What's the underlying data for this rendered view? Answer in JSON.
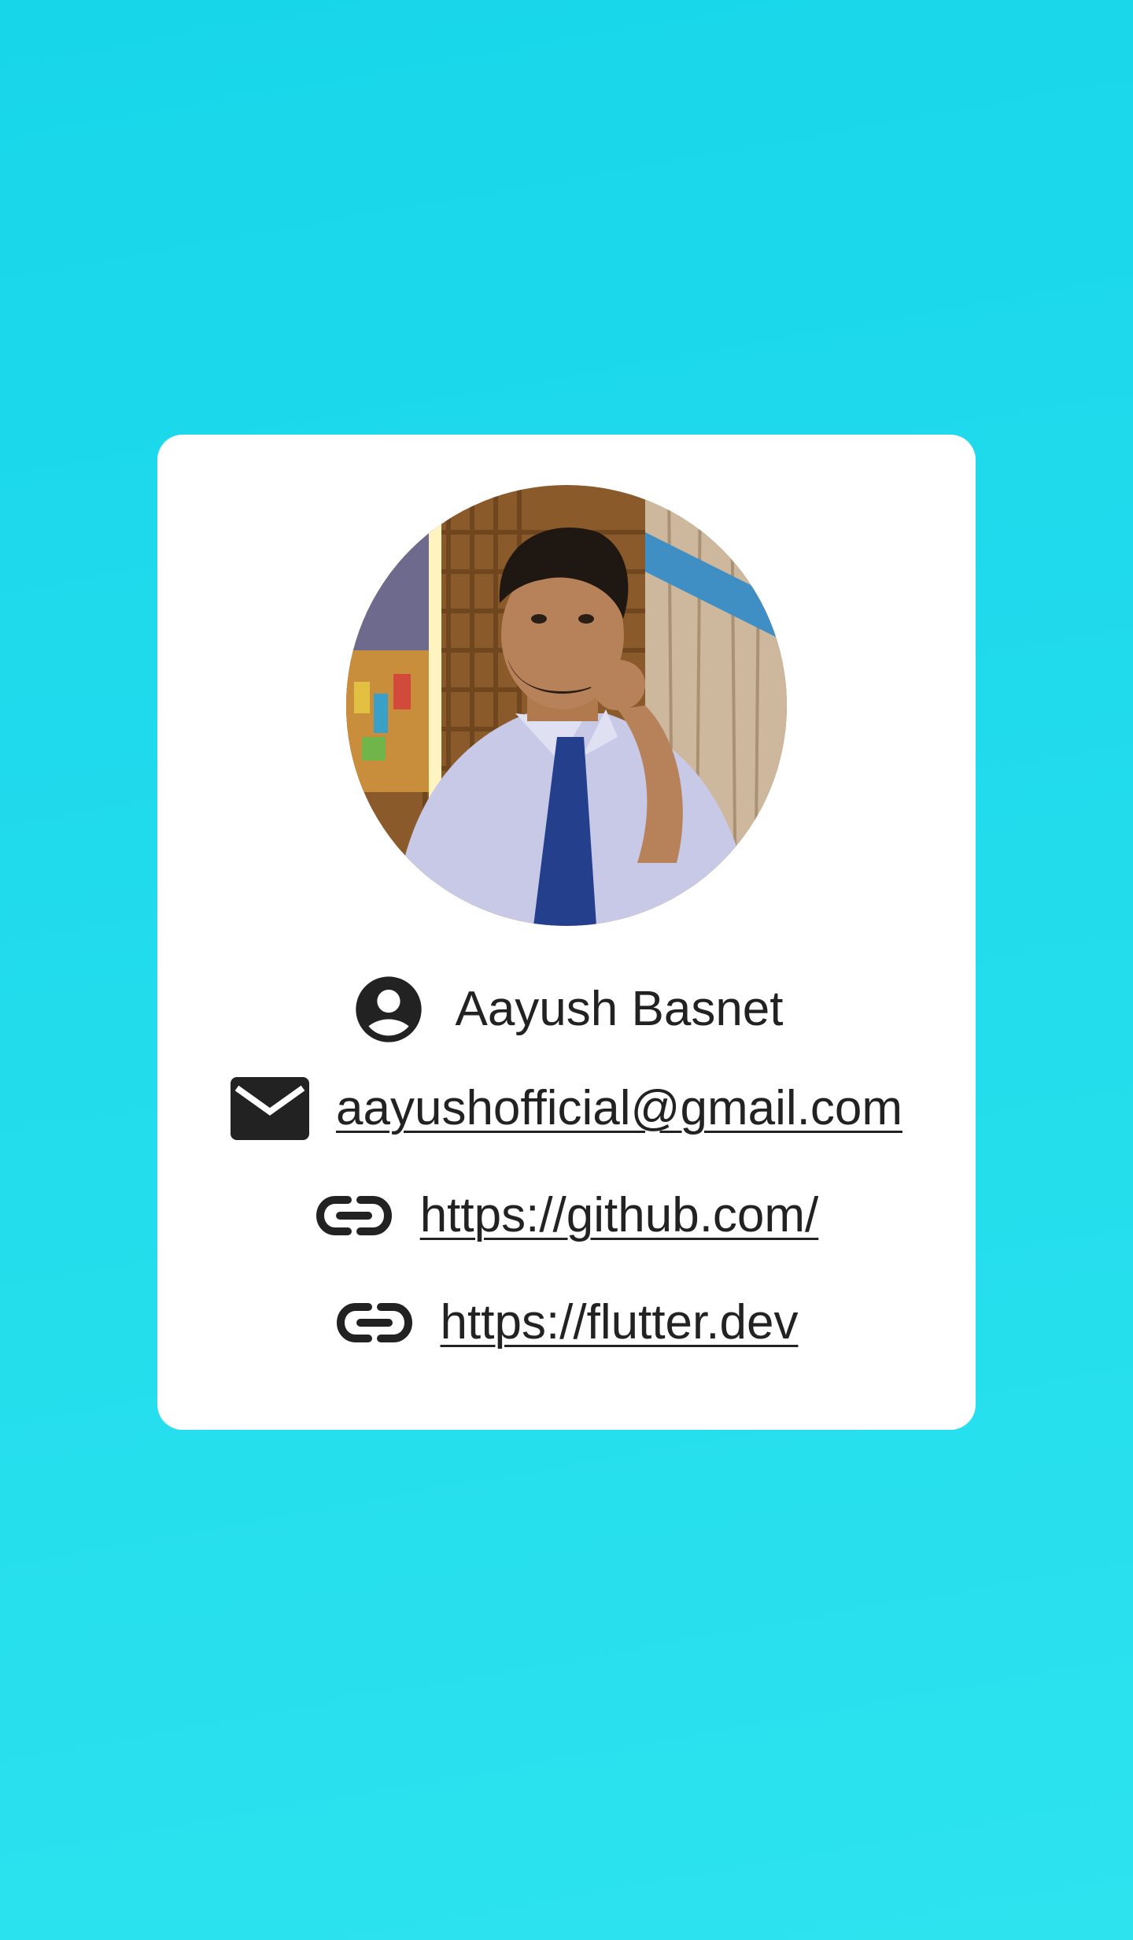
{
  "profile": {
    "name": "Aayush Basnet",
    "email": "aayushofficial@gmail.com",
    "links": [
      "https://github.com/",
      "https://flutter.dev"
    ]
  },
  "icons": {
    "name": "account-circle-icon",
    "email": "mail-icon",
    "link": "link-icon"
  },
  "colors": {
    "background_top": "#18d6ea",
    "background_bottom": "#2ce3ee",
    "card": "#ffffff",
    "text": "#222222"
  }
}
